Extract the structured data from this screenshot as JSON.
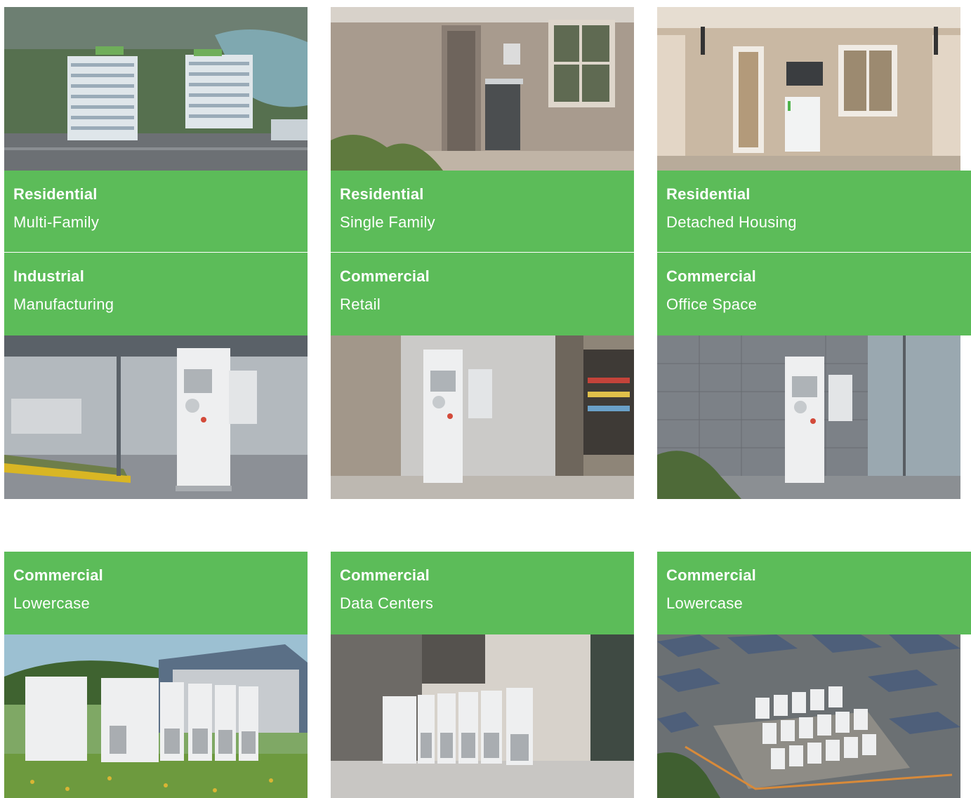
{
  "colors": {
    "band_green": "#50b74c",
    "text": "#ffffff"
  },
  "cards": [
    {
      "category": "Residential",
      "subtitle": "Multi-Family"
    },
    {
      "category": "Residential",
      "subtitle": "Single Family"
    },
    {
      "category": "Residential",
      "subtitle": "Detached Housing"
    },
    {
      "category": "Industrial",
      "subtitle": "Manufacturing"
    },
    {
      "category": "Commercial",
      "subtitle": "Retail"
    },
    {
      "category": "Commercial",
      "subtitle": "Office Space"
    },
    {
      "category": "Commercial",
      "subtitle": "Lowercase"
    },
    {
      "category": "Commercial",
      "subtitle": "Data Centers"
    },
    {
      "category": "Commercial",
      "subtitle": "Lowercase"
    }
  ]
}
